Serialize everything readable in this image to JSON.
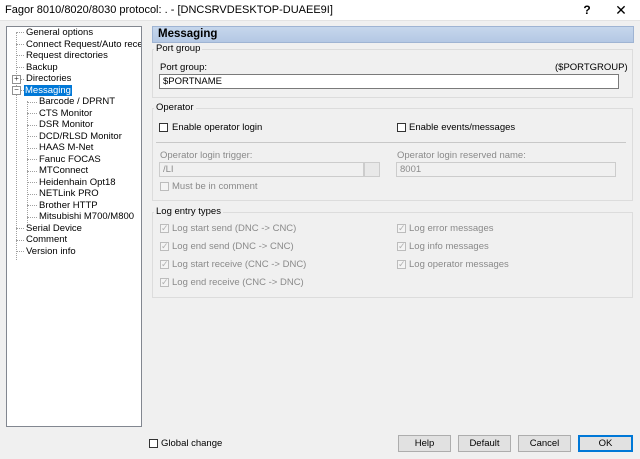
{
  "window": {
    "title": "Fagor 8010/8020/8030 protocol: . - [DNCSRVDESKTOP-DUAEE9I]",
    "help_glyph": "?",
    "close_glyph": "✕"
  },
  "tree": {
    "items": [
      {
        "label": "General options"
      },
      {
        "label": "Connect Request/Auto receive"
      },
      {
        "label": "Request directories"
      },
      {
        "label": "Backup"
      },
      {
        "label": "Directories"
      },
      {
        "label": "Messaging"
      },
      {
        "label": "Barcode / DPRNT"
      },
      {
        "label": "CTS Monitor"
      },
      {
        "label": "DSR Monitor"
      },
      {
        "label": "DCD/RLSD Monitor"
      },
      {
        "label": "HAAS M-Net"
      },
      {
        "label": "Fanuc FOCAS"
      },
      {
        "label": "MTConnect"
      },
      {
        "label": "Heidenhain Opt18"
      },
      {
        "label": "NETLink PRO"
      },
      {
        "label": "Brother HTTP"
      },
      {
        "label": "Mitsubishi M700/M800"
      },
      {
        "label": "Serial Device"
      },
      {
        "label": "Comment"
      },
      {
        "label": "Version info"
      }
    ],
    "expander_plus": "+",
    "expander_minus": "−"
  },
  "panel": {
    "header": "Messaging",
    "port_group": {
      "title": "Port group",
      "label": "Port group:",
      "variable": "($PORTGROUP)",
      "value": "$PORTNAME"
    },
    "operator": {
      "title": "Operator",
      "enable_login": "Enable operator login",
      "enable_events": "Enable events/messages",
      "trigger_label": "Operator login trigger:",
      "trigger_value": "/LI",
      "reserved_label": "Operator login reserved name:",
      "reserved_value": "8001",
      "must_comment": "Must be in comment"
    },
    "log": {
      "title": "Log entry types",
      "start_send": "Log start send (DNC -> CNC)",
      "end_send": "Log end send (DNC -> CNC)",
      "start_receive": "Log start receive (CNC -> DNC)",
      "end_receive": "Log end receive (CNC -> DNC)",
      "error_messages": "Log error messages",
      "info_messages": "Log info messages",
      "operator_messages": "Log operator messages",
      "check_glyph": "✓"
    }
  },
  "footer": {
    "global_change": "Global change",
    "help": "Help",
    "default": "Default",
    "cancel": "Cancel",
    "ok": "OK"
  }
}
